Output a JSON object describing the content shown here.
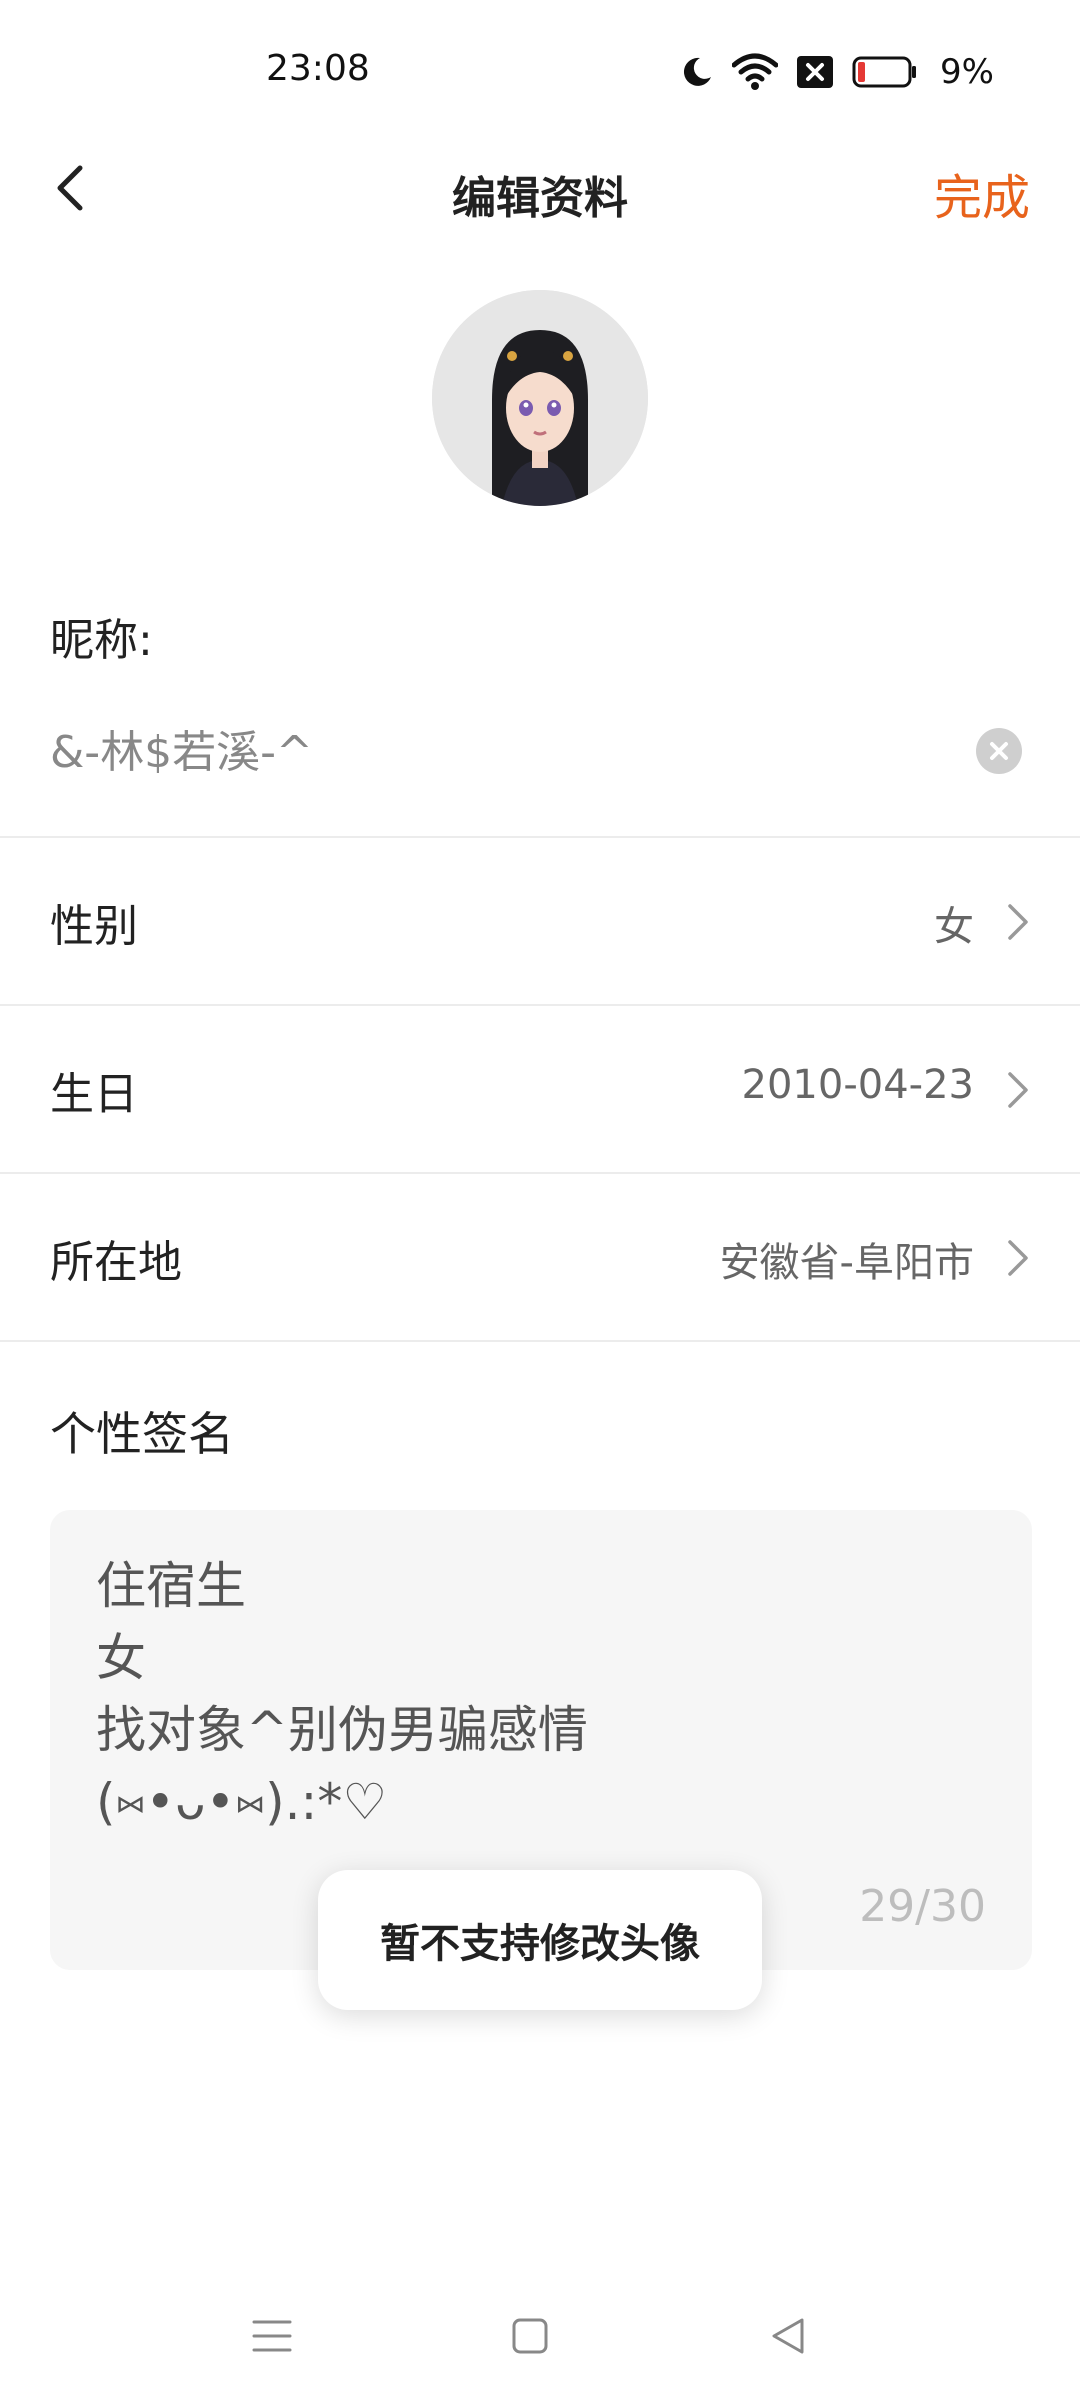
{
  "status_bar": {
    "time": "23:08",
    "battery_percent": "9%",
    "icons": [
      "moon-icon",
      "wifi-icon",
      "sim-blocked-icon",
      "battery-low-icon"
    ]
  },
  "header": {
    "title": "编辑资料",
    "done_label": "完成",
    "back_icon": "back-arrow-icon",
    "accent_color": "#e8631c"
  },
  "profile": {
    "avatar_icon": "avatar-image",
    "nickname_label": "昵称:",
    "nickname_value": "&-林$若溪-^",
    "clear_icon": "clear-icon"
  },
  "rows": [
    {
      "label": "性别",
      "value": "女"
    },
    {
      "label": "生日",
      "value": "2010-04-23"
    },
    {
      "label": "所在地",
      "value": "安徽省-阜阳市"
    }
  ],
  "signature": {
    "label": "个性签名",
    "text": "住宿生\n女\n找对象^别伪男骗感情\n(⑅•ᴗ•⑅).:*♡",
    "counter": "29/30"
  },
  "toast": {
    "message": "暂不支持修改头像"
  },
  "nav_bar": {
    "icons": [
      "menu-icon",
      "home-icon",
      "back-icon"
    ]
  }
}
